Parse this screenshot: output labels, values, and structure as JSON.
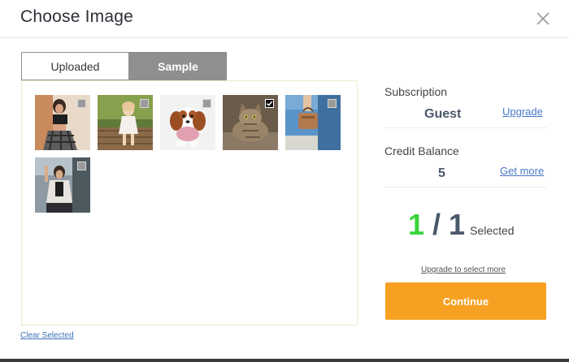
{
  "dialog": {
    "title": "Choose Image",
    "close_icon": "close-icon"
  },
  "tabs": [
    {
      "label": "Uploaded",
      "active": false
    },
    {
      "label": "Sample",
      "active": true
    }
  ],
  "gallery": {
    "images": [
      {
        "name": "woman-plaid-pants",
        "checked": false
      },
      {
        "name": "girl-in-park",
        "checked": false
      },
      {
        "name": "cavalier-puppy",
        "checked": false
      },
      {
        "name": "tabby-cat",
        "checked": true
      },
      {
        "name": "hand-holding-bag",
        "checked": false
      },
      {
        "name": "woman-with-jacket",
        "checked": false
      }
    ]
  },
  "footer": {
    "clear_selected": "Clear Selected"
  },
  "sidebar": {
    "subscription_label": "Subscription",
    "subscription_value": "Guest",
    "upgrade_link": "Upgrade",
    "credit_label": "Credit Balance",
    "credit_value": "5",
    "get_more_link": "Get more",
    "selected_count": "1",
    "slash": "/",
    "selected_total": "1",
    "selected_label": "Selected",
    "upgrade_more_link": "Upgrade to select more",
    "continue_label": "Continue"
  },
  "colors": {
    "accent_button": "#f7a122",
    "count_green": "#39d33a",
    "count_slate": "#4b586b",
    "link_blue": "#4a77c8",
    "tab_active_bg": "#8f8f8f"
  }
}
